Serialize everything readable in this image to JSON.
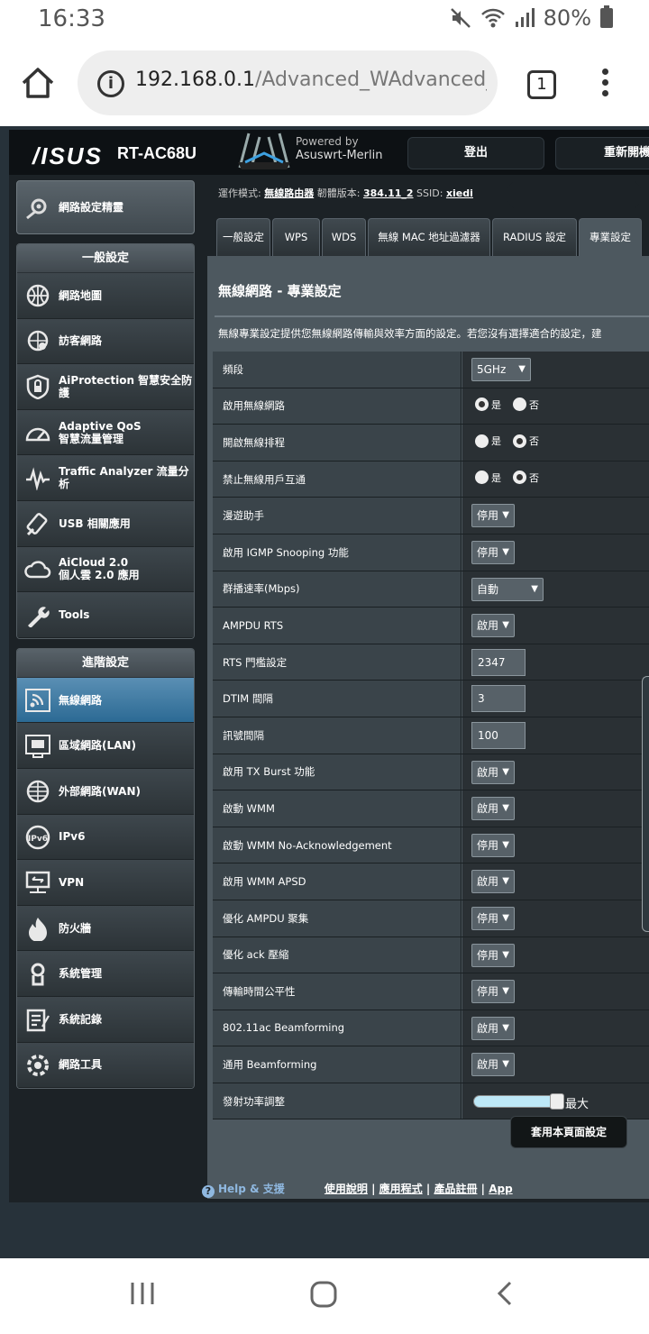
{
  "status_bar": {
    "time": "16:33",
    "battery": "80%"
  },
  "browser": {
    "url_host": "192.168.0.1",
    "url_path": "/Advanced_WAdvanced_C",
    "tab_count": "1"
  },
  "header": {
    "brand": "/ISUS",
    "model": "RT-AC68U",
    "powered_line1": "Powered by",
    "powered_line2": "Asuswrt-Merlin",
    "logout": "登出",
    "reboot": "重新開機"
  },
  "sidebar": {
    "wizard": "網路設定精靈",
    "general_title": "一般設定",
    "general_items": [
      {
        "label": "網路地圖",
        "icon": "globe-map-icon"
      },
      {
        "label": "訪客網路",
        "icon": "guest-network-icon"
      },
      {
        "label": "AiProtection 智慧安全防護",
        "icon": "shield-lock-icon"
      },
      {
        "label": "Adaptive QoS\n智慧流量管理",
        "icon": "speedometer-icon"
      },
      {
        "label": "Traffic Analyzer 流量分析",
        "icon": "waveform-icon"
      },
      {
        "label": "USB 相關應用",
        "icon": "usb-icon"
      },
      {
        "label": "AiCloud 2.0\n個人雲 2.0 應用",
        "icon": "cloud-icon"
      },
      {
        "label": "Tools",
        "icon": "wrench-icon"
      }
    ],
    "advanced_title": "進階設定",
    "advanced_items": [
      {
        "label": "無線網路",
        "icon": "wireless-icon",
        "active": true
      },
      {
        "label": "區域網路(LAN)",
        "icon": "lan-icon"
      },
      {
        "label": "外部網路(WAN)",
        "icon": "wan-globe-icon"
      },
      {
        "label": "IPv6",
        "icon": "ipv6-icon"
      },
      {
        "label": "VPN",
        "icon": "vpn-icon"
      },
      {
        "label": "防火牆",
        "icon": "firewall-icon"
      },
      {
        "label": "系統管理",
        "icon": "system-admin-icon"
      },
      {
        "label": "系統記錄",
        "icon": "system-log-icon"
      },
      {
        "label": "網路工具",
        "icon": "network-tools-icon"
      }
    ]
  },
  "info_line": {
    "mode_label": "運作模式:",
    "mode_value": "無線路由器",
    "fw_label": "韌體版本:",
    "fw_value": "384.11_2",
    "ssid_label": "SSID:",
    "ssid_value": "xiedi"
  },
  "tabs": [
    {
      "label": "一般設定"
    },
    {
      "label": "WPS"
    },
    {
      "label": "WDS"
    },
    {
      "label": "無線 MAC 地址過濾器"
    },
    {
      "label": "RADIUS 設定"
    },
    {
      "label": "專業設定",
      "active": true
    }
  ],
  "main": {
    "title": "無線網路 - 專業設定",
    "description": "無線專業設定提供您無線網路傳輸與效率方面的設定。若您沒有選擇適合的設定，建",
    "yes": "是",
    "no": "否",
    "rows": [
      {
        "label": "頻段",
        "type": "select",
        "value": "5GHz"
      },
      {
        "label": "啟用無線網路",
        "type": "radio",
        "value": "是"
      },
      {
        "label": "開啟無線排程",
        "type": "radio",
        "value": "否"
      },
      {
        "label": "禁止無線用戶互通",
        "type": "radio",
        "value": "否"
      },
      {
        "label": "漫遊助手",
        "type": "select",
        "value": "停用"
      },
      {
        "label": "啟用 IGMP Snooping 功能",
        "type": "select",
        "value": "停用"
      },
      {
        "label": "群播速率(Mbps)",
        "type": "select",
        "value": "自動"
      },
      {
        "label": "AMPDU RTS",
        "type": "select",
        "value": "啟用"
      },
      {
        "label": "RTS 門檻設定",
        "type": "text",
        "value": "2347"
      },
      {
        "label": "DTIM 間隔",
        "type": "text",
        "value": "3"
      },
      {
        "label": "訊號間隔",
        "type": "text",
        "value": "100"
      },
      {
        "label": "啟用 TX Burst 功能",
        "type": "select",
        "value": "啟用"
      },
      {
        "label": "啟動 WMM",
        "type": "select",
        "value": "啟用"
      },
      {
        "label": "啟動 WMM No-Acknowledgement",
        "type": "select",
        "value": "停用"
      },
      {
        "label": "啟用 WMM APSD",
        "type": "select",
        "value": "啟用"
      },
      {
        "label": "優化 AMPDU 聚集",
        "type": "select",
        "value": "停用"
      },
      {
        "label": "優化 ack 壓縮",
        "type": "select",
        "value": "停用"
      },
      {
        "label": "傳輸時間公平性",
        "type": "select",
        "value": "停用"
      },
      {
        "label": "802.11ac Beamforming",
        "type": "select",
        "value": "啟用"
      },
      {
        "label": "通用 Beamforming",
        "type": "select",
        "value": "啟用"
      },
      {
        "label": "發射功率調整",
        "type": "slider",
        "value": "最大",
        "level": 1.0
      }
    ],
    "apply": "套用本頁面設定"
  },
  "footer": {
    "help": "Help & 支援",
    "links": [
      "使用說明",
      "應用程式",
      "產品註冊",
      "App"
    ]
  }
}
